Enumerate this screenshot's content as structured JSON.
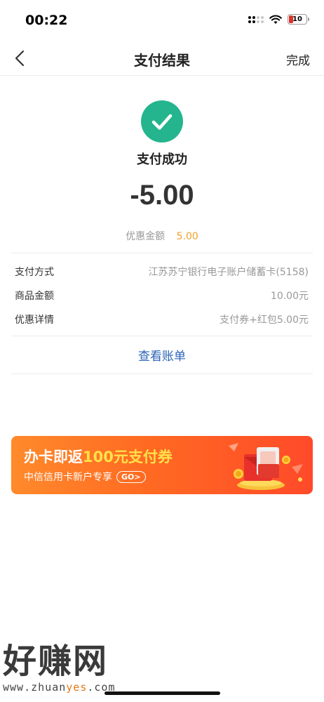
{
  "status_bar": {
    "time": "00:22",
    "battery_level": "10"
  },
  "nav": {
    "title": "支付结果",
    "done": "完成"
  },
  "result": {
    "status": "支付成功",
    "amount": "-5.00",
    "discount_label": "优惠金额",
    "discount_value": "5.00"
  },
  "details": [
    {
      "label": "支付方式",
      "value": "江苏苏宁银行电子账户储蓄卡(5158)"
    },
    {
      "label": "商品金额",
      "value": "10.00元"
    },
    {
      "label": "优惠详情",
      "value": "支付券+红包5.00元"
    }
  ],
  "view_bill": "查看账单",
  "banner": {
    "title_prefix": "办卡即返",
    "title_highlight": "100元支付券",
    "subtitle": "中信信用卡新户专享",
    "go": "GO>"
  },
  "watermark": {
    "main": "好赚网",
    "url_prefix": "www.zhuan",
    "url_highlight": "yes",
    "url_suffix": ".com"
  },
  "colors": {
    "success": "#25b58e",
    "discount": "#f0a12a",
    "link": "#2b63b5",
    "banner_start": "#ff8a2b",
    "banner_end": "#ff4a2a"
  },
  "icons": [
    "signal-icon",
    "wifi-icon",
    "battery-icon",
    "back-arrow-icon",
    "check-icon"
  ]
}
